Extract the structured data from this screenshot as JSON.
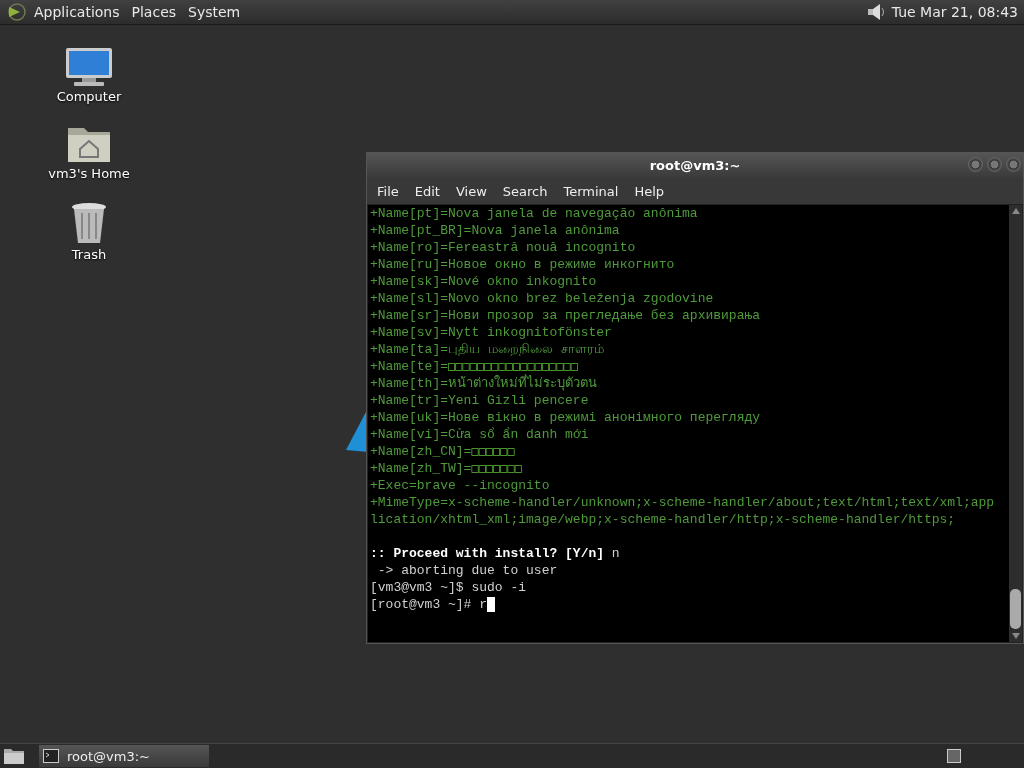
{
  "top_panel": {
    "menus": [
      "Applications",
      "Places",
      "System"
    ],
    "clock": "Tue Mar 21, 08:43"
  },
  "desktop_icons": [
    {
      "kind": "computer",
      "label": "Computer"
    },
    {
      "kind": "home",
      "label": "vm3's Home"
    },
    {
      "kind": "trash",
      "label": "Trash"
    }
  ],
  "terminal": {
    "title": "root@vm3:~",
    "menus": [
      "File",
      "Edit",
      "View",
      "Search",
      "Terminal",
      "Help"
    ],
    "lines": [
      {
        "kind": "added",
        "text": "+Name[pt]=Nova janela de navegação anônima"
      },
      {
        "kind": "added",
        "text": "+Name[pt_BR]=Nova janela anônima"
      },
      {
        "kind": "added",
        "text": "+Name[ro]=Fereastră nouă incognito"
      },
      {
        "kind": "added",
        "text": "+Name[ru]=Новое окно в режиме инкогнито"
      },
      {
        "kind": "added",
        "text": "+Name[sk]=Nové okno inkognito"
      },
      {
        "kind": "added",
        "text": "+Name[sl]=Novo okno brez beleženja zgodovine"
      },
      {
        "kind": "added",
        "text": "+Name[sr]=Нови прозор за прегледање без архивирања"
      },
      {
        "kind": "added",
        "text": "+Name[sv]=Nytt inkognitofönster"
      },
      {
        "kind": "added",
        "text": "+Name[ta]=புதிய மறைநிலை சாளரம்"
      },
      {
        "kind": "added",
        "text": "+Name[te]=",
        "tofu": "□□□□□□□□□□□□□□□□□□"
      },
      {
        "kind": "added",
        "text": "+Name[th]=หน้าต่างใหม่ที่ไม่ระบุตัวตน"
      },
      {
        "kind": "added",
        "text": "+Name[tr]=Yeni Gizli pencere"
      },
      {
        "kind": "added",
        "text": "+Name[uk]=Нове вікно в режимі анонімного перегляду"
      },
      {
        "kind": "added",
        "text": "+Name[vi]=Cửa sổ ẩn danh mới"
      },
      {
        "kind": "added",
        "text": "+Name[zh_CN]=",
        "tofu": "□□□□□□"
      },
      {
        "kind": "added",
        "text": "+Name[zh_TW]=",
        "tofu": "□□□□□□□"
      },
      {
        "kind": "added",
        "text": "+Exec=brave --incognito"
      },
      {
        "kind": "added",
        "text": "+MimeType=x-scheme-handler/unknown;x-scheme-handler/about;text/html;text/xml;app"
      },
      {
        "kind": "added",
        "text": "lication/xhtml_xml;image/webp;x-scheme-handler/http;x-scheme-handler/https;"
      },
      {
        "kind": "blank"
      },
      {
        "kind": "plain",
        "text": "**:: Proceed with install? [Y/n]** n"
      },
      {
        "kind": "plain",
        "text": " -> aborting due to user"
      },
      {
        "kind": "plain",
        "text": "[vm3@vm3 ~]$ sudo -i"
      },
      {
        "kind": "prompt",
        "text": "[root@vm3 ~]# r"
      }
    ]
  },
  "taskbar": {
    "tasks": [
      {
        "label": "root@vm3:~",
        "selected": true
      }
    ]
  }
}
